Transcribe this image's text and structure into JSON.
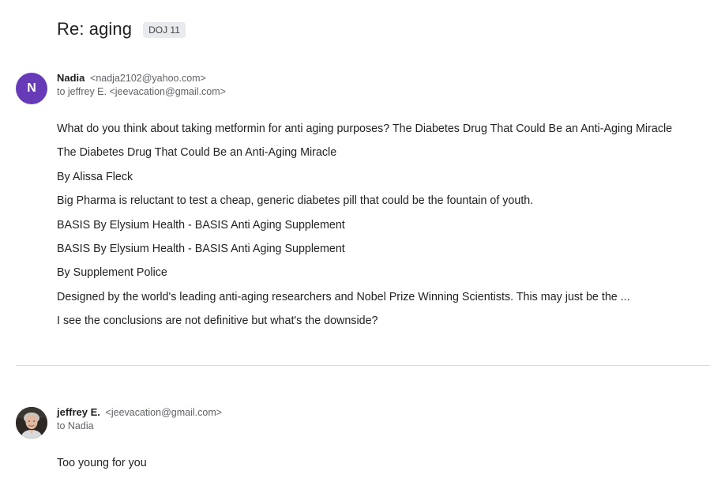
{
  "thread": {
    "subject": "Re: aging",
    "label": "DOJ 11"
  },
  "messages": [
    {
      "avatar_letter": "N",
      "avatar_color": "#673ab7",
      "sender_name": "Nadia",
      "sender_email": "<nadja2102@yahoo.com>",
      "to_line": "to jeffrey E. <jeevacation@gmail.com>",
      "body": [
        "What do you think about taking metformin for anti aging purposes? The Diabetes Drug That Could Be an Anti-Aging Miracle",
        "The Diabetes Drug That Could Be an Anti-Aging Miracle",
        "By Alissa Fleck",
        "Big Pharma is reluctant to test a cheap, generic diabetes pill that could be the fountain of youth.",
        "BASIS By Elysium Health - BASIS Anti Aging Supplement",
        "BASIS By Elysium Health - BASIS Anti Aging Supplement",
        "By Supplement Police",
        "Designed by the world's leading anti-aging researchers and Nobel Prize Winning Scientists. This may just be the ...",
        "I see the conclusions are not definitive but what's the downside?"
      ]
    },
    {
      "avatar_type": "photo",
      "sender_name": "jeffrey E.",
      "sender_email": "<jeevacation@gmail.com>",
      "to_line": "to Nadia",
      "body": [
        "Too young for you"
      ]
    }
  ]
}
